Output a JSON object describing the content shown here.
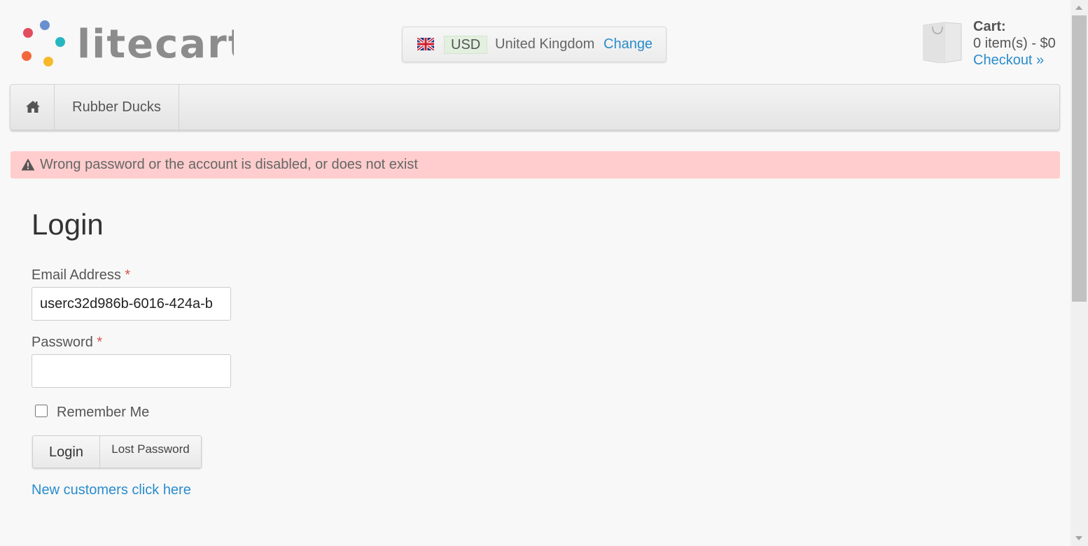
{
  "header": {
    "logo_text": "litecart",
    "region": {
      "flag_icon": "uk-flag-icon",
      "currency": "USD",
      "country": "United Kingdom",
      "change_label": "Change"
    },
    "cart": {
      "icon": "shopping-bag-icon",
      "title": "Cart:",
      "summary": "0 item(s) - $0",
      "checkout_label": "Checkout »"
    }
  },
  "nav": {
    "home_icon": "home-icon",
    "items": [
      {
        "label": "Rubber Ducks"
      }
    ]
  },
  "alert": {
    "icon": "warning-icon",
    "message": "Wrong password or the account is disabled, or does not exist",
    "color": "#ffcdcd"
  },
  "login": {
    "title": "Login",
    "email_label": "Email Address",
    "email_value": "userc32d986b-6016-424a-b",
    "password_label": "Password",
    "password_value": "",
    "required_mark": "*",
    "remember_label": "Remember Me",
    "remember_checked": false,
    "login_button": "Login",
    "lost_password_button": "Lost Password",
    "new_customers_link": "New customers click here"
  },
  "colors": {
    "link": "#2a8ccc",
    "page_background": "#f8f8f8",
    "required": "#d9534f"
  }
}
